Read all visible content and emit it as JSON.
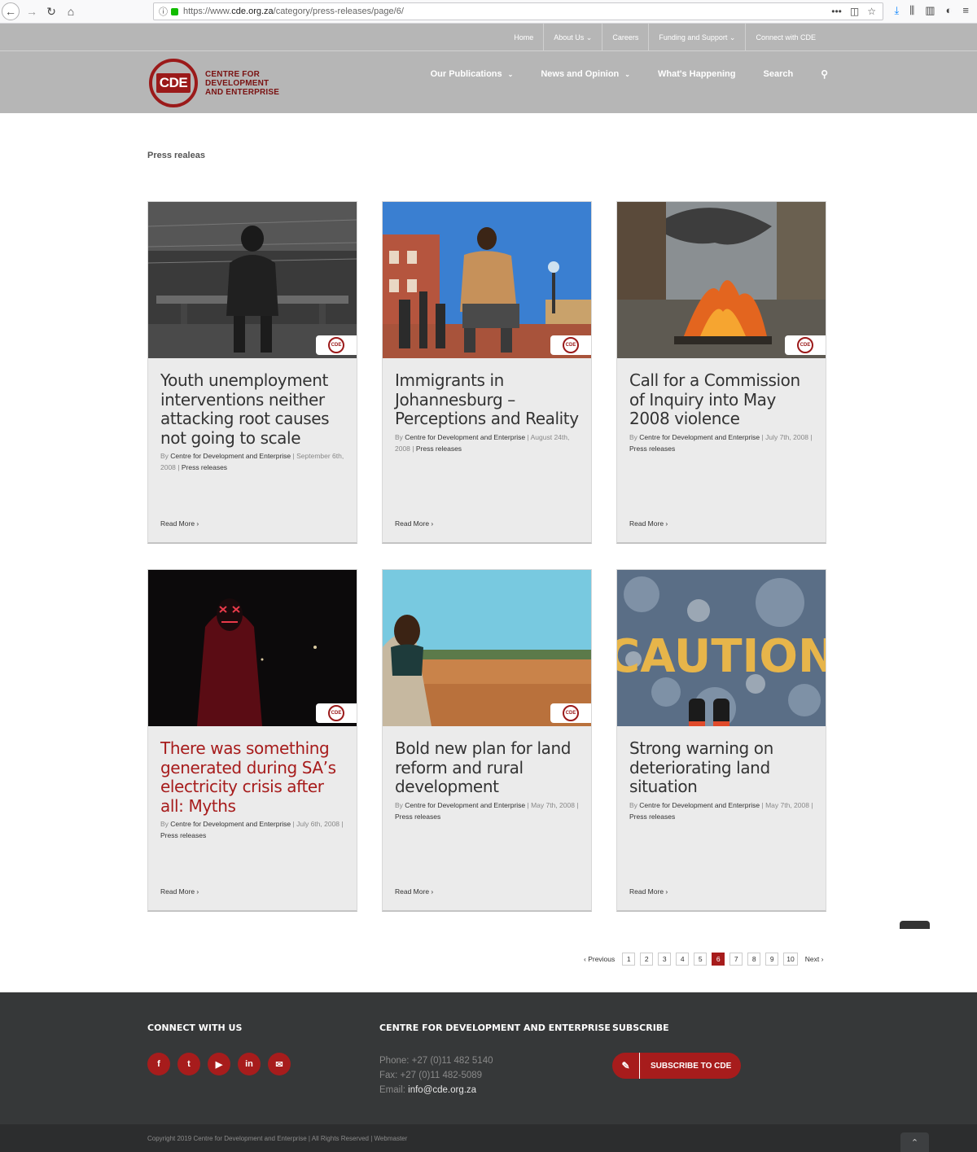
{
  "browser": {
    "url_prefix": "https://www.",
    "url_domain": "cde.org.za",
    "url_path": "/category/press-releases/page/6/"
  },
  "secondary_nav": [
    "Home",
    "About Us ⌄",
    "Careers",
    "Funding and Support ⌄",
    "Connect with CDE"
  ],
  "logo": {
    "abbr": "CDE",
    "line1": "CENTRE FOR",
    "line2": "DEVELOPMENT",
    "line3": "AND ENTERPRISE"
  },
  "main_nav": {
    "publications": "Our Publications",
    "news": "News and Opinion",
    "happening": "What's Happening",
    "search": "Search"
  },
  "page_title": "Press realeas",
  "posts": [
    {
      "title": "Youth unemployment interventions neither attacking root causes not going to scale",
      "by": "By ",
      "author": "Centre for Development and Enterprise",
      "date": " | September 6th, 2008 | ",
      "category": "Press releases",
      "read_more": "Read More ›"
    },
    {
      "title": "Immigrants in Johannesburg – Perceptions and Reality",
      "by": "By ",
      "author": "Centre for Development and Enterprise",
      "date": " | August 24th, 2008 | ",
      "category": "Press releases",
      "read_more": "Read More ›"
    },
    {
      "title": "Call for a Commission of Inquiry into May 2008 violence",
      "by": "By ",
      "author": "Centre for Development and Enterprise",
      "date": " | July 7th, 2008 | ",
      "category": "Press releases",
      "read_more": "Read More ›"
    },
    {
      "title": "There was something generated during SA’s electricity crisis after all: Myths",
      "by": "By ",
      "author": "Centre for Development and Enterprise",
      "date": " | July 6th, 2008 | ",
      "category": "Press releases",
      "read_more": "Read More ›"
    },
    {
      "title": "Bold new plan for land reform and rural development",
      "by": "By ",
      "author": "Centre for Development and Enterprise",
      "date": " | May 7th, 2008 | ",
      "category": "Press releases",
      "read_more": "Read More ›"
    },
    {
      "title": "Strong warning on deteriorating land situation",
      "by": "By ",
      "author": "Centre for Development and Enterprise",
      "date": " | May 7th, 2008 | ",
      "category": "Press releases",
      "read_more": "Read More ›"
    }
  ],
  "badge_text": "CDE",
  "caution_text": "CAUTION",
  "pagination": {
    "previous": "‹  Previous",
    "next": "Next  ›",
    "pages": [
      "1",
      "2",
      "3",
      "4",
      "5",
      "6",
      "7",
      "8",
      "9",
      "10"
    ],
    "current": "6"
  },
  "footer": {
    "connect_heading": "CONNECT WITH US",
    "centre_heading": "CENTRE FOR DEVELOPMENT AND ENTERPRISE",
    "subscribe_heading": "SUBSCRIBE",
    "phone": "Phone: +27 (0)11 482 5140",
    "fax": "Fax: +27 (0)11 482-5089",
    "email_label": "Email: ",
    "email": "info@cde.org.za",
    "subscribe_button": "SUBSCRIBE TO CDE",
    "social": [
      "f",
      "t",
      "▶",
      "in",
      "✉"
    ],
    "copyright": "Copyright 2019 Centre for Development and Enterprise | All Rights Reserved | Webmaster"
  },
  "colors": {
    "accent": "#a71c1c",
    "header_bg": "#b6b6b6",
    "footer_bg": "#363839"
  }
}
